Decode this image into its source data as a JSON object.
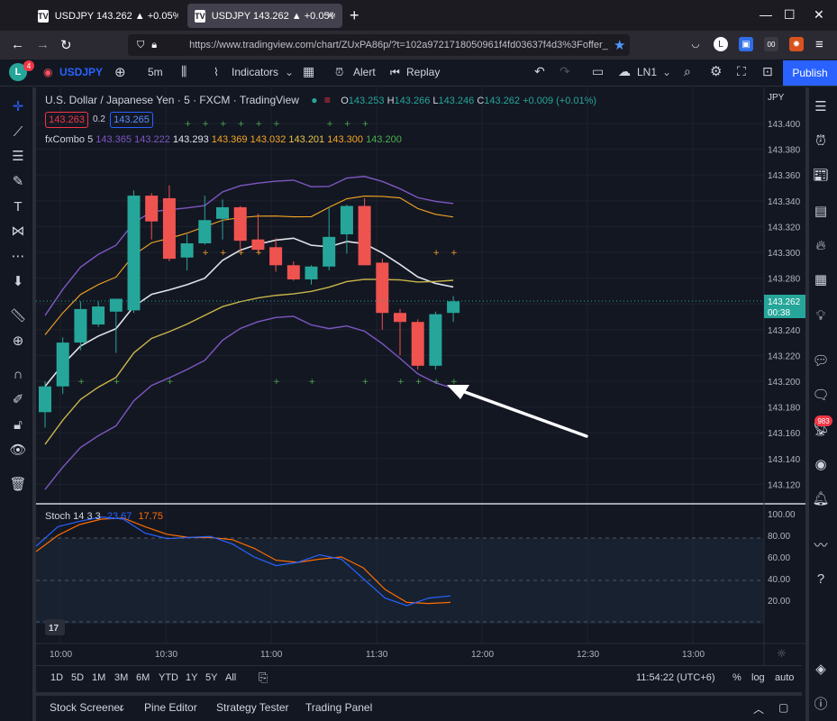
{
  "browser": {
    "tabs": [
      {
        "title": "USDJPY 143.262 ▲ +0.05% LN1",
        "favicon": "TV"
      },
      {
        "title": "USDJPY 143.262 ▲ +0.05% LN1",
        "favicon": "TV"
      }
    ],
    "url": "https://www.tradingview.com/chart/ZUxPA86p/?t=102a9721718050961f4fd03637f4d3%3Foffer_",
    "new_tab": "+",
    "ext_badge": "00",
    "win_min": "—",
    "win_max": "☐",
    "win_close": "✕"
  },
  "header": {
    "avatar_letter": "L",
    "avatar_badge": "4",
    "symbol": "USDJPY",
    "interval": "5m",
    "indicators_label": "Indicators",
    "alert_label": "Alert",
    "replay_label": "Replay",
    "layout_name": "LN1",
    "publish_label": "Publish"
  },
  "legend": {
    "title": "U.S. Dollar / Japanese Yen · 5 · FXCM · TradingView",
    "o_label": "O",
    "o": "143.253",
    "h_label": "H",
    "h": "143.266",
    "l_label": "L",
    "l": "143.246",
    "c_label": "C",
    "c": "143.262",
    "change": "+0.009 (+0.01%)",
    "bid": "143.263",
    "spread": "0.2",
    "ask": "143.265",
    "indicator_name": "fxCombo 5",
    "ind_v1": "143.365",
    "ind_v2": "143.222",
    "ind_v3": "143.293",
    "ind_v4": "143.369",
    "ind_v5": "143.032",
    "ind_v6": "143.201",
    "ind_v7": "143.300",
    "ind_v8": "143.200",
    "stoch_name": "Stoch 14 3 3",
    "stoch_k": "23.67",
    "stoch_d": "17.75"
  },
  "price_axis": {
    "currency": "JPY",
    "ticks": [
      "143.400",
      "143.380",
      "143.360",
      "143.340",
      "143.320",
      "143.300",
      "143.280",
      "143.260",
      "143.240",
      "143.220",
      "143.200",
      "143.180",
      "143.160",
      "143.140",
      "143.120"
    ],
    "last_price": "143.262",
    "countdown": "00:38"
  },
  "stoch_axis": {
    "ticks": [
      "100.00",
      "80.00",
      "60.00",
      "40.00",
      "20.00"
    ]
  },
  "time_axis": {
    "ticks": [
      "10:00",
      "10:30",
      "11:00",
      "11:30",
      "12:00",
      "12:30",
      "13:00"
    ]
  },
  "timebar": {
    "ranges": [
      "1D",
      "5D",
      "1M",
      "3M",
      "6M",
      "YTD",
      "1Y",
      "5Y",
      "All"
    ],
    "clock": "11:54:22 (UTC+6)",
    "pct": "%",
    "log": "log",
    "auto": "auto"
  },
  "panels": [
    "Stock Screener",
    "Pine Editor",
    "Strategy Tester",
    "Trading Panel"
  ],
  "right_badge": "983",
  "chart_data": {
    "type": "candlestick",
    "title": "U.S. Dollar / Japanese Yen · 5 · FXCM · TradingView",
    "ylim": [
      143.11,
      143.41
    ],
    "candles": [
      {
        "t": "09:55",
        "o": 143.176,
        "h": 143.2,
        "l": 143.164,
        "c": 143.196
      },
      {
        "t": "10:00",
        "o": 143.196,
        "h": 143.234,
        "l": 143.19,
        "c": 143.23
      },
      {
        "t": "10:05",
        "o": 143.23,
        "h": 143.262,
        "l": 143.224,
        "c": 143.256
      },
      {
        "t": "10:10",
        "o": 143.244,
        "h": 143.262,
        "l": 143.242,
        "c": 143.258
      },
      {
        "t": "10:15",
        "o": 143.254,
        "h": 143.262,
        "l": 143.222,
        "c": 143.264
      },
      {
        "t": "10:20",
        "o": 143.255,
        "h": 143.348,
        "l": 143.253,
        "c": 143.344
      },
      {
        "t": "10:25",
        "o": 143.344,
        "h": 143.346,
        "l": 143.31,
        "c": 143.324
      },
      {
        "t": "10:30",
        "o": 143.342,
        "h": 143.352,
        "l": 143.293,
        "c": 143.295
      },
      {
        "t": "10:35",
        "o": 143.296,
        "h": 143.314,
        "l": 143.286,
        "c": 143.307
      },
      {
        "t": "10:40",
        "o": 143.307,
        "h": 143.344,
        "l": 143.306,
        "c": 143.325
      },
      {
        "t": "10:45",
        "o": 143.326,
        "h": 143.341,
        "l": 143.31,
        "c": 143.335
      },
      {
        "t": "10:50",
        "o": 143.335,
        "h": 143.336,
        "l": 143.301,
        "c": 143.309
      },
      {
        "t": "10:55",
        "o": 143.31,
        "h": 143.33,
        "l": 143.3,
        "c": 143.302
      },
      {
        "t": "11:00",
        "o": 143.304,
        "h": 143.311,
        "l": 143.285,
        "c": 143.29
      },
      {
        "t": "11:05",
        "o": 143.29,
        "h": 143.293,
        "l": 143.278,
        "c": 143.279
      },
      {
        "t": "11:10",
        "o": 143.279,
        "h": 143.29,
        "l": 143.275,
        "c": 143.289
      },
      {
        "t": "11:15",
        "o": 143.289,
        "h": 143.335,
        "l": 143.286,
        "c": 143.312
      },
      {
        "t": "11:20",
        "o": 143.314,
        "h": 143.337,
        "l": 143.299,
        "c": 143.336
      },
      {
        "t": "11:25",
        "o": 143.336,
        "h": 143.342,
        "l": 143.29,
        "c": 143.29
      },
      {
        "t": "11:30",
        "o": 143.292,
        "h": 143.295,
        "l": 143.24,
        "c": 143.253
      },
      {
        "t": "11:35",
        "o": 143.253,
        "h": 143.256,
        "l": 143.22,
        "c": 143.246
      },
      {
        "t": "11:40",
        "o": 143.246,
        "h": 143.248,
        "l": 143.209,
        "c": 143.212
      },
      {
        "t": "11:45",
        "o": 143.212,
        "h": 143.254,
        "l": 143.209,
        "c": 143.252
      },
      {
        "t": "11:50",
        "o": 143.253,
        "h": 143.266,
        "l": 143.246,
        "c": 143.262
      }
    ],
    "stoch": {
      "k": [
        70,
        88,
        93,
        97,
        95,
        82,
        77,
        78,
        79,
        72,
        60,
        52,
        55,
        62,
        58,
        40,
        22,
        15,
        22,
        24
      ],
      "d": [
        65,
        80,
        90,
        95,
        96,
        88,
        81,
        78,
        78,
        76,
        68,
        57,
        55,
        58,
        60,
        50,
        30,
        18,
        17,
        18
      ],
      "ylim": [
        0,
        100
      ]
    }
  }
}
